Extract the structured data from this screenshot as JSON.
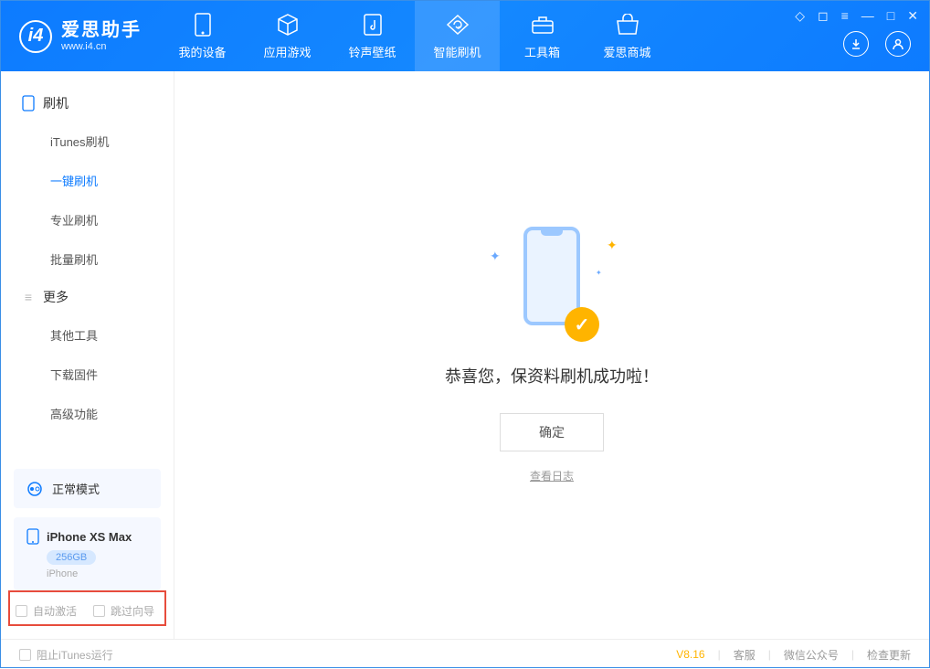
{
  "header": {
    "logo_title": "爱思助手",
    "logo_sub": "www.i4.cn",
    "tabs": [
      {
        "label": "我的设备",
        "icon": "device"
      },
      {
        "label": "应用游戏",
        "icon": "cube"
      },
      {
        "label": "铃声壁纸",
        "icon": "music"
      },
      {
        "label": "智能刷机",
        "icon": "refresh"
      },
      {
        "label": "工具箱",
        "icon": "toolbox"
      },
      {
        "label": "爱思商城",
        "icon": "shop"
      }
    ]
  },
  "sidebar": {
    "section1_title": "刷机",
    "items1": [
      {
        "label": "iTunes刷机"
      },
      {
        "label": "一键刷机"
      },
      {
        "label": "专业刷机"
      },
      {
        "label": "批量刷机"
      }
    ],
    "section2_title": "更多",
    "items2": [
      {
        "label": "其他工具"
      },
      {
        "label": "下载固件"
      },
      {
        "label": "高级功能"
      }
    ],
    "mode_label": "正常模式",
    "device": {
      "name": "iPhone XS Max",
      "storage": "256GB",
      "type": "iPhone"
    },
    "checkbox1": "自动激活",
    "checkbox2": "跳过向导"
  },
  "main": {
    "success_text": "恭喜您，保资料刷机成功啦！",
    "confirm_label": "确定",
    "view_log_label": "查看日志"
  },
  "footer": {
    "block_itunes": "阻止iTunes运行",
    "version": "V8.16",
    "link1": "客服",
    "link2": "微信公众号",
    "link3": "检查更新"
  }
}
